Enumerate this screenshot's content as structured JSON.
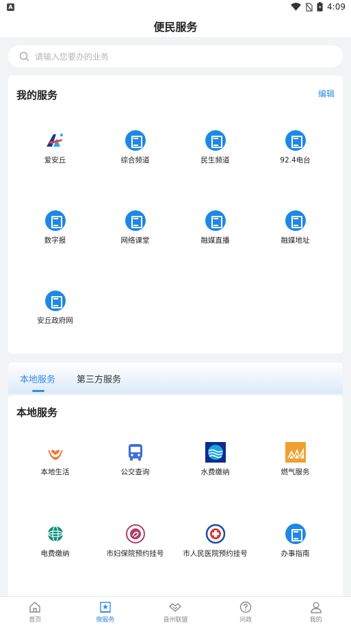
{
  "status_bar": {
    "time": "4:09",
    "left_icon": "A"
  },
  "header": {
    "title": "便民服务"
  },
  "search": {
    "placeholder": "请输入您要办的业务"
  },
  "my_services": {
    "title": "我的服务",
    "edit_label": "编辑",
    "items": [
      {
        "label": "爱安丘",
        "icon": "aianqiu-logo-icon"
      },
      {
        "label": "综合频道",
        "icon": "document-icon"
      },
      {
        "label": "民生频道",
        "icon": "document-icon"
      },
      {
        "label": "92.4电台",
        "icon": "document-icon"
      },
      {
        "label": "数字报",
        "icon": "document-icon"
      },
      {
        "label": "网络课堂",
        "icon": "document-icon"
      },
      {
        "label": "融媒直播",
        "icon": "document-icon"
      },
      {
        "label": "融媒地址",
        "icon": "document-icon"
      },
      {
        "label": "安丘政府网",
        "icon": "document-icon"
      }
    ]
  },
  "service_tabs": [
    {
      "label": "本地服务",
      "active": true
    },
    {
      "label": "第三方服务",
      "active": false
    }
  ],
  "local_services": {
    "title": "本地服务",
    "items": [
      {
        "label": "本地生活",
        "icon": "hands-heart-icon"
      },
      {
        "label": "公交查询",
        "icon": "bus-icon"
      },
      {
        "label": "水费缴纳",
        "icon": "water-icon"
      },
      {
        "label": "燃气服务",
        "icon": "gas-icon"
      },
      {
        "label": "电费缴纳",
        "icon": "state-grid-icon"
      },
      {
        "label": "市妇保院预约挂号",
        "icon": "maternity-hospital-icon"
      },
      {
        "label": "市人民医院预约挂号",
        "icon": "hospital-icon"
      },
      {
        "label": "办事指南",
        "icon": "document-icon"
      }
    ]
  },
  "bottom_nav": [
    {
      "label": "首页",
      "icon": "home-icon",
      "active": false
    },
    {
      "label": "微服务",
      "icon": "star-bookmark-icon",
      "active": true
    },
    {
      "label": "县州联盟",
      "icon": "handshake-icon",
      "active": false
    },
    {
      "label": "问政",
      "icon": "question-icon",
      "active": false
    },
    {
      "label": "我的",
      "icon": "person-icon",
      "active": false
    }
  ],
  "colors": {
    "accent": "#2f8ce8",
    "doc_icon_blue": "#1e88e5",
    "background": "#f2f3f5"
  }
}
